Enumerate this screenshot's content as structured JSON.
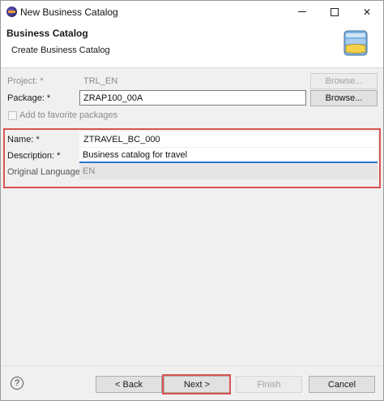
{
  "window": {
    "title": "New Business Catalog"
  },
  "banner": {
    "title": "Business Catalog",
    "subtitle": "Create Business Catalog",
    "icon": "catalog-icon"
  },
  "form": {
    "project_label": "Project: *",
    "project_value": "TRL_EN",
    "project_browse": "Browse...",
    "package_label": "Package: *",
    "package_value": "ZRAP100_00A",
    "package_browse": "Browse...",
    "favorite_label": "Add to favorite packages",
    "name_label": "Name: *",
    "name_value": "ZTRAVEL_BC_000",
    "description_label": "Description: *",
    "description_value": "Business catalog for travel",
    "original_language_label": "Original Language:",
    "original_language_value": "EN"
  },
  "footer": {
    "help": "?",
    "back": "< Back",
    "next": "Next >",
    "finish": "Finish",
    "cancel": "Cancel"
  },
  "colors": {
    "highlight": "#d9534f",
    "background": "#f0f0f0"
  }
}
